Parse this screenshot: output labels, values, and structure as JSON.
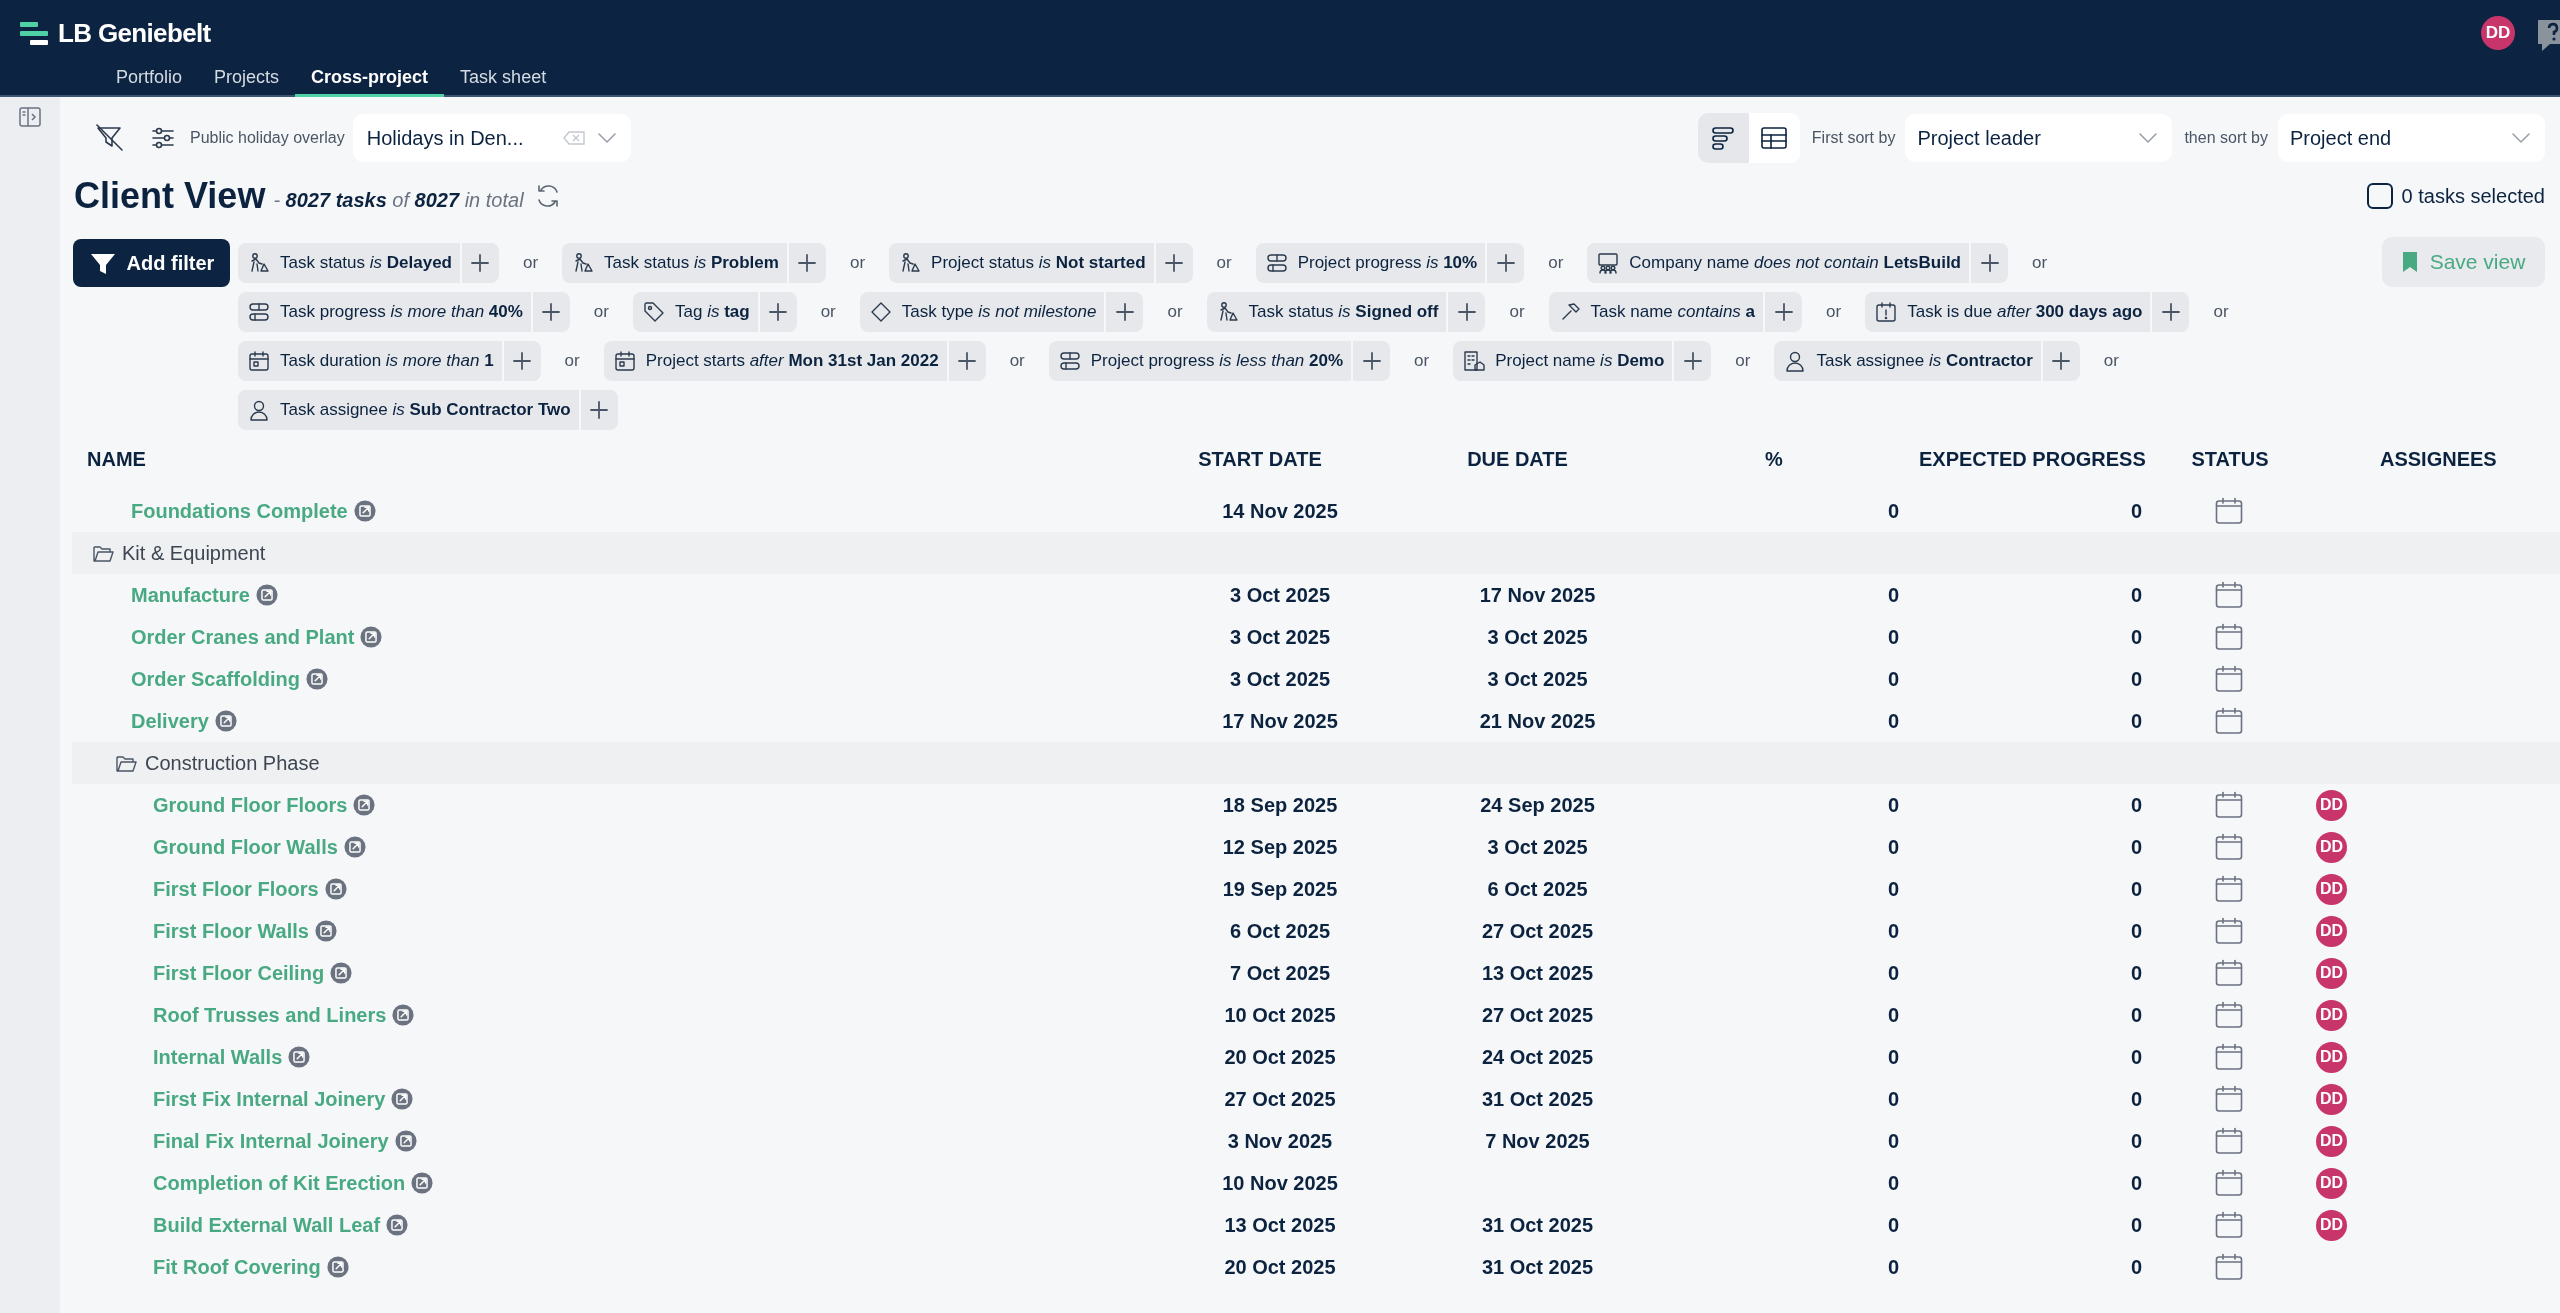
{
  "app": {
    "brand": "LB Geniebelt",
    "avatar": "DD",
    "nav": [
      {
        "label": "Portfolio",
        "selected": false
      },
      {
        "label": "Projects",
        "selected": false
      },
      {
        "label": "Cross-project",
        "selected": true
      },
      {
        "label": "Task sheet",
        "selected": false
      }
    ]
  },
  "toolbar": {
    "holiday_label": "Public holiday overlay",
    "holiday_value": "Holidays in Den...",
    "views": [
      {
        "kind": "gantt",
        "selected": true
      },
      {
        "kind": "table",
        "selected": false
      }
    ],
    "first_sort_label": "First sort by",
    "first_sort": "Project leader",
    "then_sort_label": "then sort by",
    "then_sort": "Project end"
  },
  "header": {
    "title": "Client View",
    "summary": "- **8027 tasks** of **8027** in total",
    "selection": {
      "label": "0 tasks selected",
      "checked": false
    }
  },
  "filters": {
    "add_label": "Add filter",
    "save_label": "Save view",
    "conditions": [
      {
        "kind": "status",
        "text": "Task status *is* **Delayed**",
        "joiner": "or"
      },
      {
        "kind": "status",
        "text": "Task status *is* **Problem**",
        "joiner": "or"
      },
      {
        "kind": "status",
        "text": "Project status *is* **Not started**",
        "joiner": "or"
      },
      {
        "kind": "progress",
        "text": "Project progress *is* **10%**",
        "joiner": "or"
      },
      {
        "kind": "company",
        "text": "Company name *does not contain* **LetsBuild**",
        "joiner": "or"
      },
      {
        "kind": "progress",
        "text": "Task progress *is more than* **40%**",
        "joiner": "or"
      },
      {
        "kind": "tag",
        "text": "Tag *is* **tag**",
        "joiner": "or"
      },
      {
        "kind": "type",
        "text": "Task type *is not milestone*",
        "joiner": "or"
      },
      {
        "kind": "status",
        "text": "Task status *is* **Signed off**",
        "joiner": "or"
      },
      {
        "kind": "name",
        "text": "Task name *contains* **a**",
        "joiner": "or"
      },
      {
        "kind": "due",
        "text": "Task is due *after* **300 days ago**",
        "joiner": "or"
      },
      {
        "kind": "date",
        "text": "Task duration *is more than* **1**",
        "joiner": "or"
      },
      {
        "kind": "date",
        "text": "Project starts *after* **Mon 31st Jan 2022**",
        "joiner": "or"
      },
      {
        "kind": "progress",
        "text": "Project progress *is less than* **20%**",
        "joiner": "or"
      },
      {
        "kind": "project",
        "text": "Project name *is* **Demo**",
        "joiner": "or"
      },
      {
        "kind": "person",
        "text": "Task assignee *is* **Contractor**",
        "joiner": "or"
      },
      {
        "kind": "person",
        "text": "Task assignee *is* **Sub Contractor Two**"
      }
    ]
  },
  "table": {
    "columns": [
      "NAME",
      "START DATE",
      "DUE DATE",
      "%",
      "EXPECTED PROGRESS",
      "STATUS",
      "ASSIGNEES"
    ],
    "rows": [
      {
        "kind": "task",
        "name": "Foundations Complete",
        "start": "14 Nov 2025",
        "percent": "0",
        "expected": "0"
      },
      {
        "kind": "group",
        "name": "Kit & Equipment",
        "children": [
          {
            "kind": "task",
            "name": "Manufacture",
            "start": "3 Oct 2025",
            "due": "17 Nov 2025",
            "percent": "0",
            "expected": "0"
          },
          {
            "kind": "task",
            "name": "Order Cranes and Plant",
            "start": "3 Oct 2025",
            "due": "3 Oct 2025",
            "percent": "0",
            "expected": "0"
          },
          {
            "kind": "task",
            "name": "Order Scaffolding",
            "start": "3 Oct 2025",
            "due": "3 Oct 2025",
            "percent": "0",
            "expected": "0"
          },
          {
            "kind": "task",
            "name": "Delivery",
            "start": "17 Nov 2025",
            "due": "21 Nov 2025",
            "percent": "0",
            "expected": "0"
          },
          {
            "kind": "group",
            "name": "Construction Phase",
            "children": [
              {
                "kind": "task",
                "name": "Ground Floor Floors",
                "start": "18 Sep 2025",
                "due": "24 Sep 2025",
                "percent": "0",
                "expected": "0",
                "assignee": "DD"
              },
              {
                "kind": "task",
                "name": "Ground Floor Walls",
                "start": "12 Sep 2025",
                "due": "3 Oct 2025",
                "percent": "0",
                "expected": "0",
                "assignee": "DD"
              },
              {
                "kind": "task",
                "name": "First Floor Floors",
                "start": "19 Sep 2025",
                "due": "6 Oct 2025",
                "percent": "0",
                "expected": "0",
                "assignee": "DD"
              },
              {
                "kind": "task",
                "name": "First Floor Walls",
                "start": "6 Oct 2025",
                "due": "27 Oct 2025",
                "percent": "0",
                "expected": "0",
                "assignee": "DD"
              },
              {
                "kind": "task",
                "name": "First Floor Ceiling",
                "start": "7 Oct 2025",
                "due": "13 Oct 2025",
                "percent": "0",
                "expected": "0",
                "assignee": "DD"
              },
              {
                "kind": "task",
                "name": "Roof Trusses and Liners",
                "start": "10 Oct 2025",
                "due": "27 Oct 2025",
                "percent": "0",
                "expected": "0",
                "assignee": "DD"
              },
              {
                "kind": "task",
                "name": "Internal Walls",
                "start": "20 Oct 2025",
                "due": "24 Oct 2025",
                "percent": "0",
                "expected": "0",
                "assignee": "DD"
              },
              {
                "kind": "task",
                "name": "First Fix Internal Joinery",
                "start": "27 Oct 2025",
                "due": "31 Oct 2025",
                "percent": "0",
                "expected": "0",
                "assignee": "DD"
              },
              {
                "kind": "task",
                "name": "Final Fix Internal Joinery",
                "start": "3 Nov 2025",
                "due": "7 Nov 2025",
                "percent": "0",
                "expected": "0",
                "assignee": "DD"
              },
              {
                "kind": "task",
                "name": "Completion of Kit Erection",
                "start": "10 Nov 2025",
                "percent": "0",
                "expected": "0",
                "assignee": "DD"
              },
              {
                "kind": "task",
                "name": "Build External Wall Leaf",
                "start": "13 Oct 2025",
                "due": "31 Oct 2025",
                "percent": "0",
                "expected": "0",
                "assignee": "DD"
              },
              {
                "kind": "task",
                "name": "Fit Roof Covering",
                "start": "20 Oct 2025",
                "due": "31 Oct 2025",
                "percent": "0",
                "expected": "0"
              }
            ]
          }
        ]
      }
    ]
  }
}
